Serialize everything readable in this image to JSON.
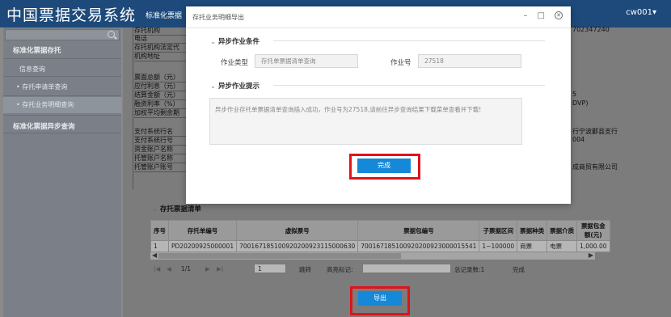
{
  "app": {
    "title": "中国票据交易系统",
    "top_nav": "标准化票据",
    "user": "cw001▾"
  },
  "sidebar": {
    "groups": [
      {
        "label": "标准化票据存托"
      },
      {
        "label": "标准化票据异步查询"
      }
    ],
    "items": [
      {
        "label": "信息查询"
      },
      {
        "label": "• 存托申请单查询"
      },
      {
        "label": "• 存托业务明细查询"
      }
    ]
  },
  "background": {
    "left_labels": [
      "存托机构",
      "电话",
      "存托机构法定代",
      "机构地址",
      "",
      "票面总额（元）",
      "应付利息（元）",
      "结算金额（元）",
      "融资利率（%）",
      "加权平均剩余期",
      "",
      "支付系统行名",
      "支付系统行号",
      "资金账户名称",
      "托管账户名称",
      "托管账户账号"
    ],
    "right_texts": [
      "702347240",
      "5",
      "DVP)",
      "行宁波鄞县支行",
      "004",
      "成商贸有限公司"
    ]
  },
  "modal": {
    "title": "存托业务明细导出",
    "section1": "异步作业条件",
    "job_type_label": "作业类型",
    "job_type_value": "存托单票据清单查询",
    "job_no_label": "作业号",
    "job_no_value": "27518",
    "section2": "异步作业提示",
    "message": "异步作业存托单票据清单查询插入成功，作业号为27518,请前往异步查询结果下载菜单查看并下载!",
    "done_label": "完成"
  },
  "table": {
    "title": "存托票据清单",
    "headers": [
      "序号",
      "存托单编号",
      "虚拟票号",
      "票据包编号",
      "子票据区间",
      "票据种类",
      "票据介质",
      "票据包金额(元)"
    ],
    "rows": [
      [
        "1",
        "PD20200925000001",
        "700167185100920200923115000630",
        "700167185100920200923000015541",
        "1~100000",
        "商票",
        "电票",
        "1,000.00"
      ]
    ]
  },
  "pager": {
    "current": "1/1",
    "page_value": "1",
    "jump_label": "跳转",
    "highlight_label": "高亮标记:",
    "total": "总记录数:1",
    "status": "完成"
  },
  "export_label": "导出",
  "colors": {
    "header": "#1d4a7a",
    "primary": "#1688d8",
    "highlight": "#e0121b"
  }
}
